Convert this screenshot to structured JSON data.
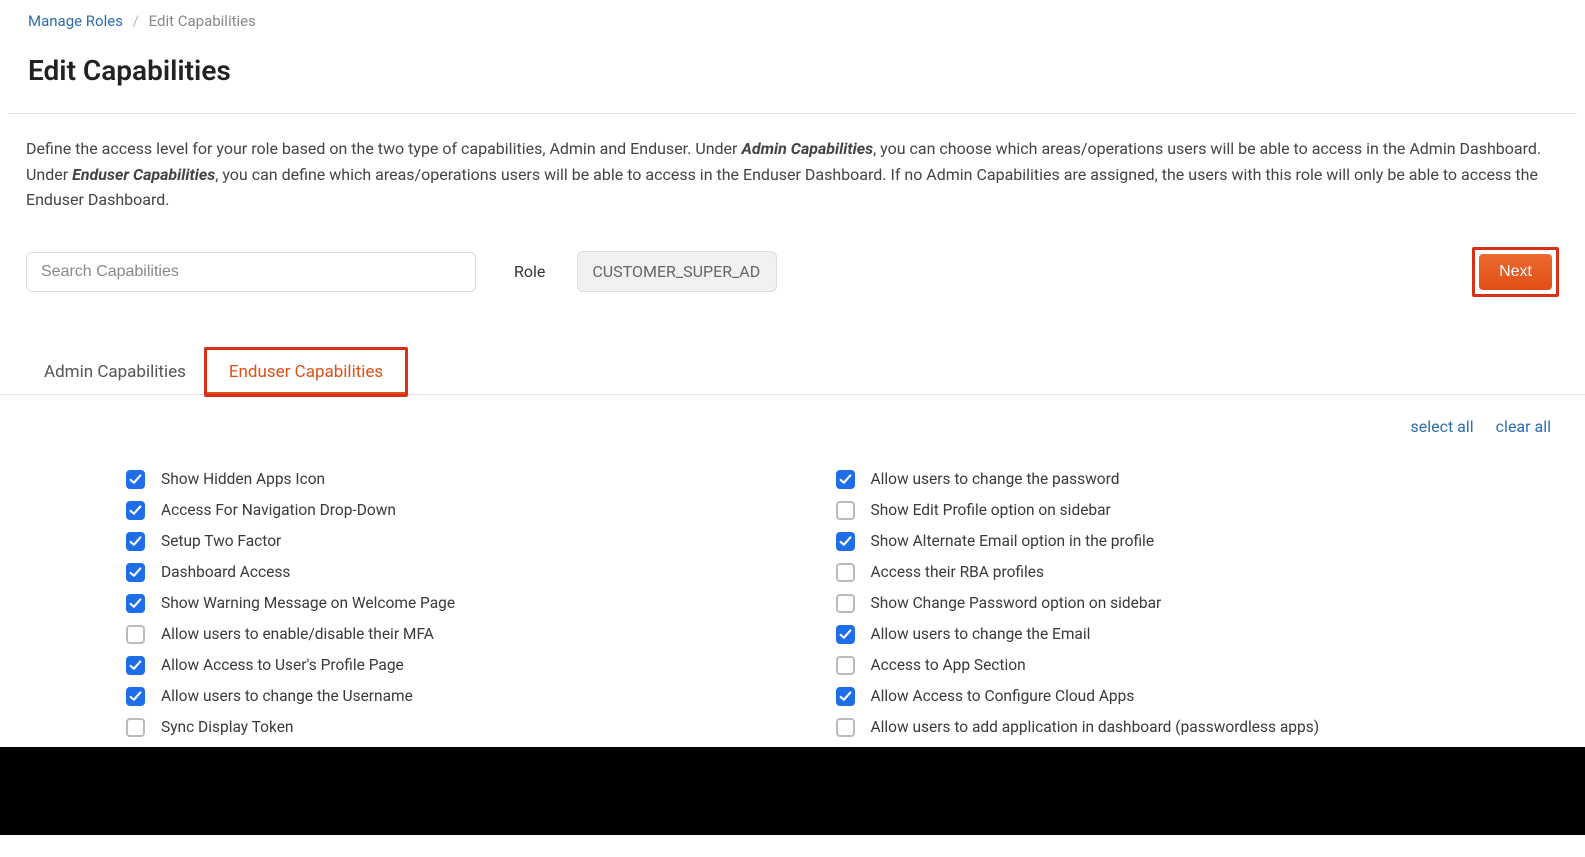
{
  "breadcrumb": {
    "parent": "Manage Roles",
    "current": "Edit Capabilities"
  },
  "page_title": "Edit Capabilities",
  "description": {
    "part1": "Define the access level for your role based on the two type of capabilities, Admin and Enduser. Under ",
    "bold1": "Admin Capabilities",
    "part2": ", you can choose which areas/operations users will be able to access in the Admin Dashboard. Under ",
    "bold2": "Enduser Capabilities",
    "part3": ", you can define which areas/operations users will be able to access in the Enduser Dashboard. If no Admin Capabilities are assigned, the users with this role will only be able to access the Enduser Dashboard."
  },
  "search": {
    "placeholder": "Search Capabilities"
  },
  "role": {
    "label": "Role",
    "value": "CUSTOMER_SUPER_AD"
  },
  "next_label": "Next",
  "tabs": {
    "admin": "Admin Capabilities",
    "enduser": "Enduser Capabilities"
  },
  "bulk": {
    "select_all": "select all",
    "clear_all": "clear all"
  },
  "capabilities": {
    "left": [
      {
        "label": "Show Hidden Apps Icon",
        "checked": true
      },
      {
        "label": "Access For Navigation Drop-Down",
        "checked": true
      },
      {
        "label": "Setup Two Factor",
        "checked": true
      },
      {
        "label": "Dashboard Access",
        "checked": true
      },
      {
        "label": "Show Warning Message on Welcome Page",
        "checked": true
      },
      {
        "label": "Allow users to enable/disable their MFA",
        "checked": false
      },
      {
        "label": "Allow Access to User's Profile Page",
        "checked": true
      },
      {
        "label": "Allow users to change the Username",
        "checked": true
      },
      {
        "label": "Sync Display Token",
        "checked": false
      }
    ],
    "right": [
      {
        "label": "Allow users to change the password",
        "checked": true
      },
      {
        "label": "Show Edit Profile option on sidebar",
        "checked": false
      },
      {
        "label": "Show Alternate Email option in the profile",
        "checked": true
      },
      {
        "label": "Access their RBA profiles",
        "checked": false
      },
      {
        "label": "Show Change Password option on sidebar",
        "checked": false
      },
      {
        "label": "Allow users to change the Email",
        "checked": true
      },
      {
        "label": "Access to App Section",
        "checked": false
      },
      {
        "label": "Allow Access to Configure Cloud Apps",
        "checked": true
      },
      {
        "label": "Allow users to add application in dashboard (passwordless apps)",
        "checked": false
      }
    ]
  }
}
